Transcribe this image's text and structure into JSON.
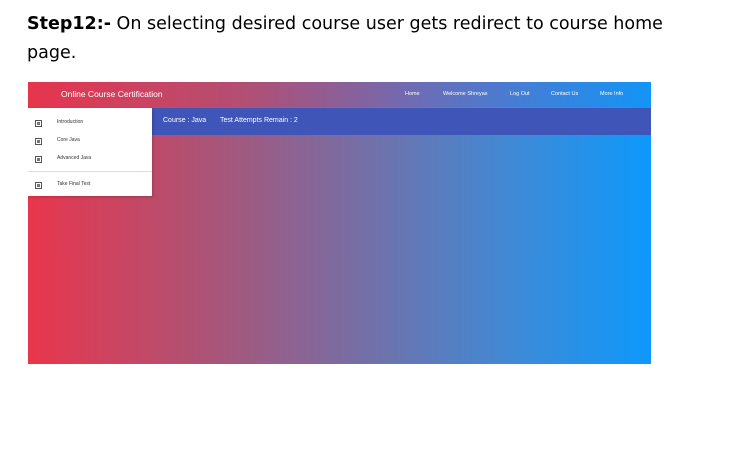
{
  "document": {
    "step_label": "Step12:-",
    "step_text": " On selecting desired course user gets redirect to course home page."
  },
  "app": {
    "brand": "Online Course Certification",
    "nav": {
      "home": "Home",
      "welcome": "Welcome Shreyas",
      "logout": "Log Out",
      "contact": "Contact Us",
      "more": "More Info"
    },
    "course_bar": {
      "course": "Course : Java",
      "attempts": "Test Attempts Remain : 2"
    },
    "sidebar": {
      "items": [
        {
          "label": "Introduction",
          "icon": "box-icon"
        },
        {
          "label": "Core Java",
          "icon": "box-icon"
        },
        {
          "label": "Advanced Java",
          "icon": "box-icon"
        },
        {
          "label": "Take Final Test",
          "icon": "box-icon"
        }
      ]
    },
    "colors": {
      "gradient_start": "#e9364c",
      "gradient_end": "#0d99fb",
      "course_bar": "#3f56b8"
    }
  }
}
